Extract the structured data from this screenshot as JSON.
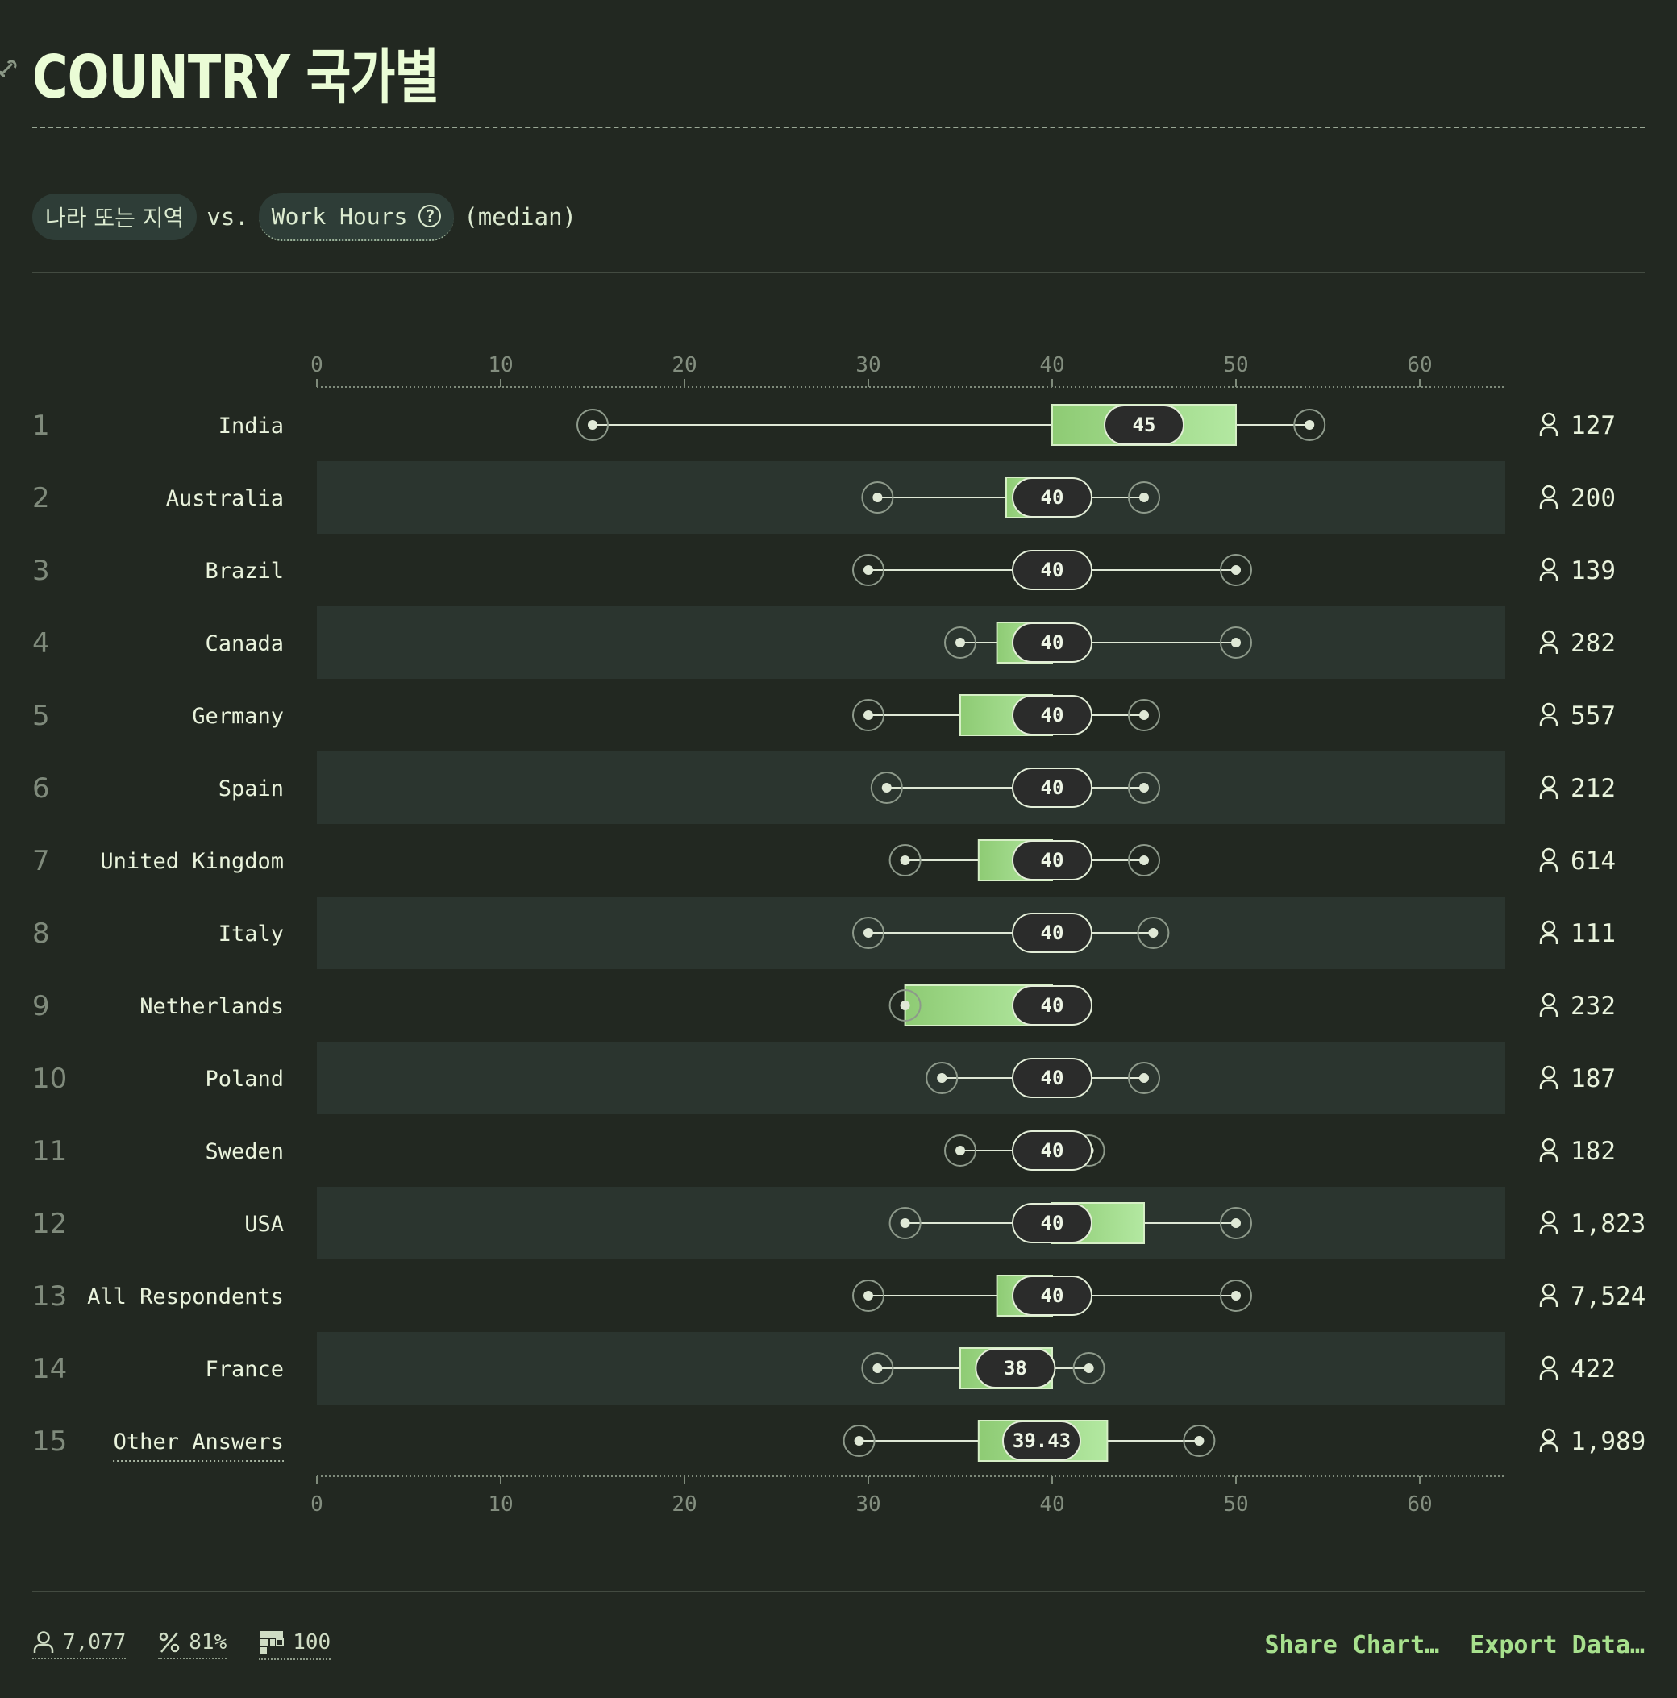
{
  "header": {
    "title": "COUNTRY 국가별",
    "subtitle_pill_1": "나라 또는 지역",
    "subtitle_vs": "vs.",
    "subtitle_pill_2": "Work Hours",
    "subtitle_help_icon": "question-circle-icon",
    "subtitle_note": "(median)"
  },
  "chart_data": {
    "type": "boxplot",
    "x_axis": {
      "min": 0,
      "max": 65,
      "ticks": [
        0,
        10,
        20,
        30,
        40,
        50,
        60
      ]
    },
    "grid": false,
    "colors": {
      "box_left": "#8ecb74",
      "box_right": "#b3e8a1",
      "median_pill": "#2b2c2b",
      "whisker": "#dfe8d6"
    },
    "rows": [
      {
        "rank": 1,
        "label": "India",
        "min": 15,
        "q1": 40,
        "median": 45,
        "q3": 50,
        "max": 54,
        "count": "127"
      },
      {
        "rank": 2,
        "label": "Australia",
        "min": 30.5,
        "q1": 37.5,
        "median": 40,
        "q3": 40,
        "max": 45,
        "count": "200"
      },
      {
        "rank": 3,
        "label": "Brazil",
        "min": 30,
        "q1": 40,
        "median": 40,
        "q3": 40,
        "max": 50,
        "count": "139"
      },
      {
        "rank": 4,
        "label": "Canada",
        "min": 35,
        "q1": 37,
        "median": 40,
        "q3": 40,
        "max": 50,
        "count": "282"
      },
      {
        "rank": 5,
        "label": "Germany",
        "min": 30,
        "q1": 35,
        "median": 40,
        "q3": 40,
        "max": 45,
        "count": "557"
      },
      {
        "rank": 6,
        "label": "Spain",
        "min": 31,
        "q1": 40,
        "median": 40,
        "q3": 40,
        "max": 45,
        "count": "212"
      },
      {
        "rank": 7,
        "label": "United Kingdom",
        "min": 32,
        "q1": 36,
        "median": 40,
        "q3": 40,
        "max": 45,
        "count": "614"
      },
      {
        "rank": 8,
        "label": "Italy",
        "min": 30,
        "q1": 40,
        "median": 40,
        "q3": 40,
        "max": 45.5,
        "count": "111"
      },
      {
        "rank": 9,
        "label": "Netherlands",
        "min": 32,
        "q1": 32,
        "median": 40,
        "q3": 40,
        "max": 40,
        "count": "232"
      },
      {
        "rank": 10,
        "label": "Poland",
        "min": 34,
        "q1": 40,
        "median": 40,
        "q3": 40,
        "max": 45,
        "count": "187"
      },
      {
        "rank": 11,
        "label": "Sweden",
        "min": 35,
        "q1": 40,
        "median": 40,
        "q3": 40,
        "max": 42,
        "count": "182"
      },
      {
        "rank": 12,
        "label": "USA",
        "min": 32,
        "q1": 40,
        "median": 40,
        "q3": 45,
        "max": 50,
        "count": "1,823"
      },
      {
        "rank": 13,
        "label": "All Respondents",
        "min": 30,
        "q1": 37,
        "median": 40,
        "q3": 40,
        "max": 50,
        "count": "7,524"
      },
      {
        "rank": 14,
        "label": "France",
        "min": 30.5,
        "q1": 35,
        "median": 38,
        "q3": 40,
        "max": 42,
        "count": "422"
      },
      {
        "rank": 15,
        "label": "Other Answers",
        "min": 29.5,
        "q1": 36,
        "median": 39.43,
        "q3": 43,
        "max": 48,
        "count": "1,989"
      }
    ]
  },
  "footer": {
    "respondents": "7,077",
    "percent": "81%",
    "questions": "100",
    "share_label": "Share Chart…",
    "export_label": "Export Data…"
  }
}
